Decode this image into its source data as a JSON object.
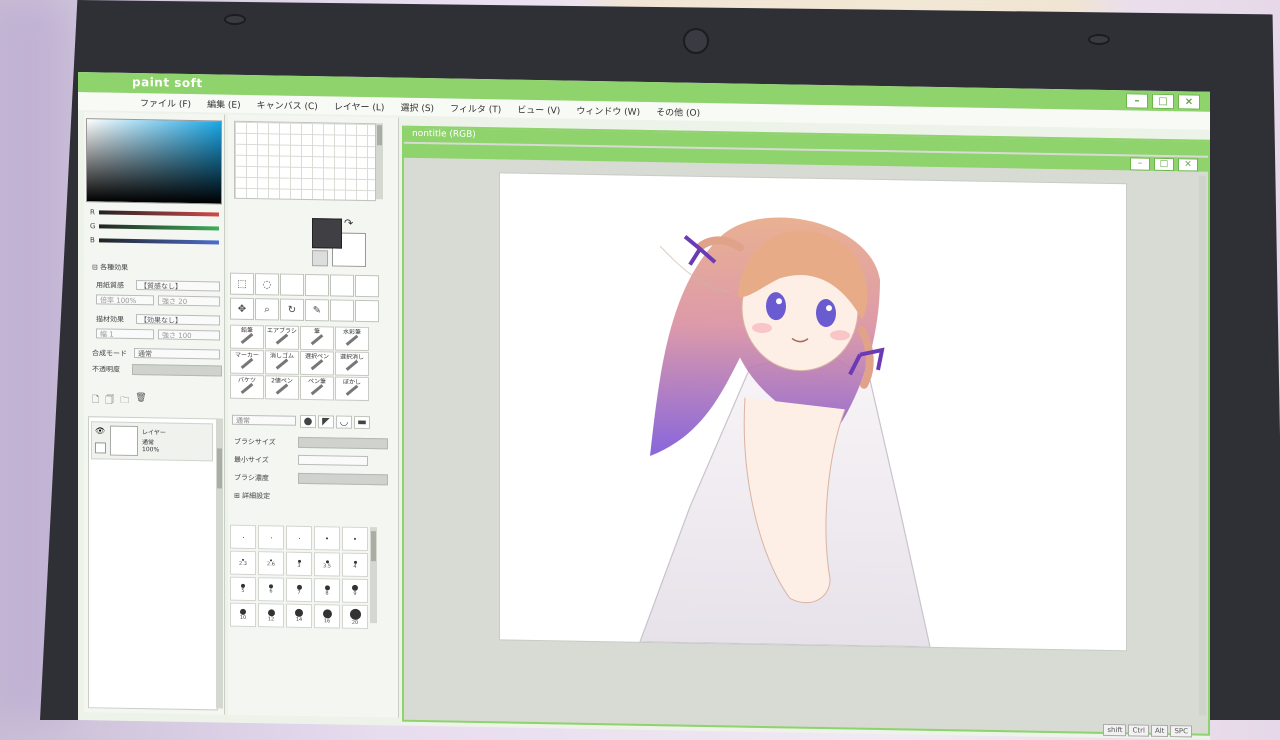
{
  "app": {
    "title": "paint soft",
    "window_buttons": [
      "–",
      "□",
      "×"
    ]
  },
  "menu": [
    "ファイル (F)",
    "編集 (E)",
    "キャンバス (C)",
    "レイヤー (L)",
    "選択 (S)",
    "フィルタ (T)",
    "ビュー (V)",
    "ウィンドウ (W)",
    "その他 (O)"
  ],
  "color_panel": {
    "channels": [
      {
        "label": "R",
        "color": "#d04a4a"
      },
      {
        "label": "G",
        "color": "#3fae5a"
      },
      {
        "label": "B",
        "color": "#4a6fd0"
      }
    ]
  },
  "blend_section": {
    "header": "各種効果",
    "rows": [
      {
        "label": "用紙質感",
        "value": "【質感なし】",
        "sub": [
          "倍率",
          "100%",
          "強さ",
          "20"
        ]
      },
      {
        "label": "描材効果",
        "value": "【効果なし】",
        "sub": [
          "幅",
          "1",
          "強さ",
          "100"
        ]
      }
    ],
    "mode_label": "合成モード",
    "mode_value": "通常",
    "opacity_label": "不透明度"
  },
  "layer": {
    "name": "レイヤー",
    "mode": "通常",
    "opacity": "100%"
  },
  "brushes": [
    {
      "name": "鉛筆"
    },
    {
      "name": "エアブラシ"
    },
    {
      "name": "筆"
    },
    {
      "name": "水彩筆"
    },
    {
      "name": "マーカー"
    },
    {
      "name": "消しゴム"
    },
    {
      "name": "選択ペン"
    },
    {
      "name": "選択消し"
    },
    {
      "name": "バケツ"
    },
    {
      "name": "2値ペン"
    },
    {
      "name": "ペン筆"
    },
    {
      "name": "ぼかし"
    }
  ],
  "brush_settings": {
    "mode_value": "通常",
    "size_label": "ブラシサイズ",
    "min_size_label": "最小サイズ",
    "density_label": "ブラシ濃度",
    "detail_label": "詳細設定"
  },
  "brush_sizes": [
    "",
    "",
    "",
    "",
    "",
    "2.3",
    "2.6",
    "3",
    "3.5",
    "4",
    "5",
    "6",
    "7",
    "8",
    "9",
    "10",
    "12",
    "14",
    "16",
    "20"
  ],
  "canvas": {
    "title": "nontitle (RGB)"
  },
  "status_keys": [
    "shift",
    "Ctrl",
    "Alt",
    "SPC"
  ]
}
